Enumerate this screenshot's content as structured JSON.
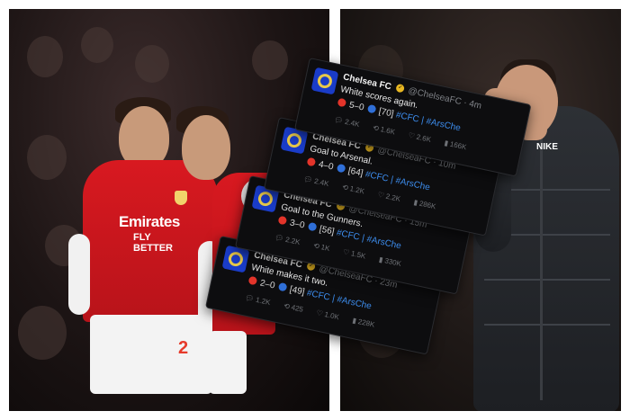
{
  "tweets": [
    {
      "name": "Chelsea FC",
      "handle": "@ChelseaFC · 4m",
      "text": "White scores again.",
      "home_score": "5–0",
      "minute": "[70]",
      "tags": "#CFC | #ArsChe",
      "stats": {
        "replies": "2.4K",
        "reposts": "1.6K",
        "likes": "2.6K",
        "views": "166K"
      }
    },
    {
      "name": "Chelsea FC",
      "handle": "@ChelseaFC · 10m",
      "text": "Goal to Arsenal.",
      "home_score": "4–0",
      "minute": "[64]",
      "tags": "#CFC | #ArsChe",
      "stats": {
        "replies": "2.4K",
        "reposts": "1.2K",
        "likes": "2.2K",
        "views": "286K"
      }
    },
    {
      "name": "Chelsea FC",
      "handle": "@ChelseaFC · 15m",
      "text": "Goal to the Gunners.",
      "home_score": "3–0",
      "minute": "[56]",
      "tags": "#CFC | #ArsChe",
      "stats": {
        "replies": "2.2K",
        "reposts": "1K",
        "likes": "1.5K",
        "views": "330K"
      }
    },
    {
      "name": "Chelsea FC",
      "handle": "@ChelseaFC · 23m",
      "text": "White makes it two.",
      "home_score": "2–0",
      "minute": "[49]",
      "tags": "#CFC | #ArsChe",
      "stats": {
        "replies": "1.2K",
        "reposts": "425",
        "likes": "1.0K",
        "views": "228K"
      }
    }
  ],
  "photo_left": {
    "sponsor": "Emirates",
    "sponsor_sub": "FLY BETTER",
    "kit_number": "2"
  },
  "photo_right": {
    "coat_logo": "NIKE"
  },
  "colors": {
    "arsenal_red": "#d81920",
    "chelsea_blue": "#1a3cc8",
    "tweet_bg": "#0d0d0f",
    "hashtag": "#3d8ef0"
  }
}
